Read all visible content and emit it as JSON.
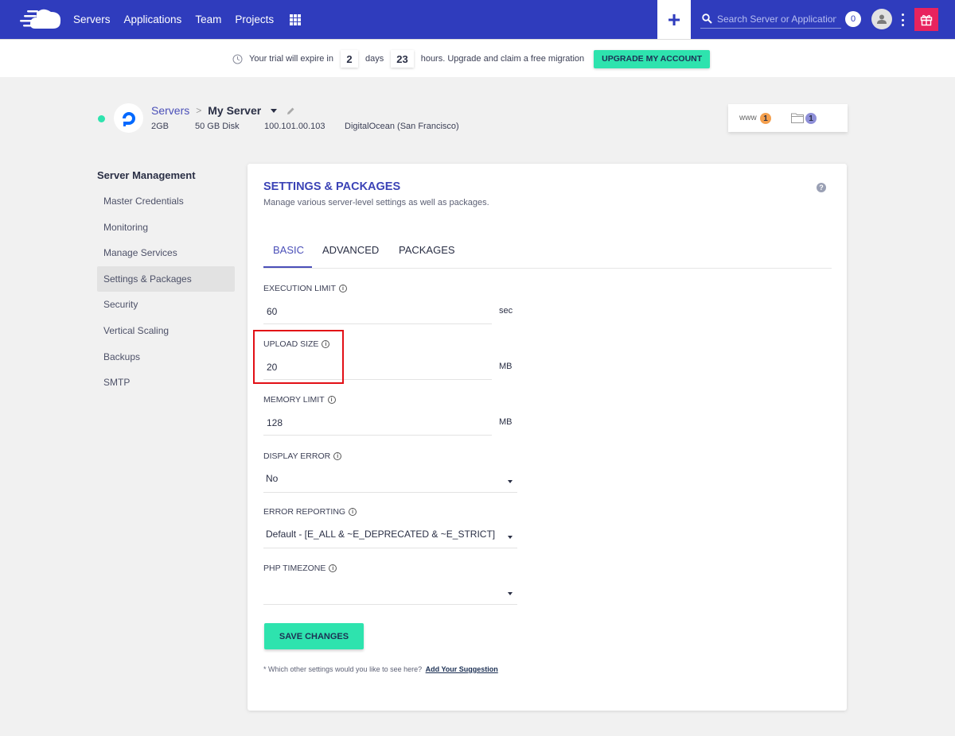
{
  "topnav": {
    "brand_color": "#2f3cbd",
    "links": [
      "Servers",
      "Applications",
      "Team",
      "Projects"
    ],
    "apps_grid_icon": "grid-icon",
    "add_icon": "plus-icon",
    "search_placeholder": "Search Server or Application",
    "notification_count": "0",
    "avatar_icon": "user-icon",
    "more_icon": "kebab-icon",
    "gift_icon": "gift-icon",
    "gift_color": "#e8235e"
  },
  "trial": {
    "prefix": "Your trial will expire in",
    "days": "2",
    "days_label": "days",
    "hours": "23",
    "suffix": "hours. Upgrade and claim a free migration",
    "upgrade_label": "UPGRADE MY ACCOUNT",
    "accent": "#2ee3ae"
  },
  "server": {
    "status": "online",
    "breadcrumb_parent": "Servers",
    "name": "My Server",
    "ram": "2GB",
    "disk": "50 GB Disk",
    "ip": "100.101.00.103",
    "provider": "DigitalOcean (San Francisco)",
    "www_label": "www",
    "www_count": "1",
    "folder_count": "1"
  },
  "sidebar": {
    "title": "Server Management",
    "items": [
      {
        "label": "Master Credentials",
        "active": false
      },
      {
        "label": "Monitoring",
        "active": false
      },
      {
        "label": "Manage Services",
        "active": false
      },
      {
        "label": "Settings & Packages",
        "active": true
      },
      {
        "label": "Security",
        "active": false
      },
      {
        "label": "Vertical Scaling",
        "active": false
      },
      {
        "label": "Backups",
        "active": false
      },
      {
        "label": "SMTP",
        "active": false
      }
    ]
  },
  "main": {
    "title": "SETTINGS & PACKAGES",
    "subtitle": "Manage various server-level settings as well as packages.",
    "help_glyph": "?",
    "tabs": [
      {
        "label": "BASIC",
        "active": true
      },
      {
        "label": "ADVANCED",
        "active": false
      },
      {
        "label": "PACKAGES",
        "active": false
      }
    ],
    "fields": {
      "execution_limit": {
        "label": "EXECUTION LIMIT",
        "value": "60",
        "unit": "sec"
      },
      "upload_size": {
        "label": "UPLOAD SIZE",
        "value": "20",
        "unit": "MB"
      },
      "memory_limit": {
        "label": "MEMORY LIMIT",
        "value": "128",
        "unit": "MB"
      },
      "display_error": {
        "label": "DISPLAY ERROR",
        "value": "No"
      },
      "error_reporting": {
        "label": "ERROR REPORTING",
        "value": "Default - [E_ALL & ~E_DEPRECATED & ~E_STRICT]"
      },
      "php_timezone": {
        "label": "PHP TIMEZONE",
        "value": ""
      }
    },
    "info_glyph": "i",
    "save_label": "SAVE CHANGES",
    "suggest_text": "* Which other settings would you like to see here?",
    "suggest_link": "Add Your Suggestion"
  }
}
